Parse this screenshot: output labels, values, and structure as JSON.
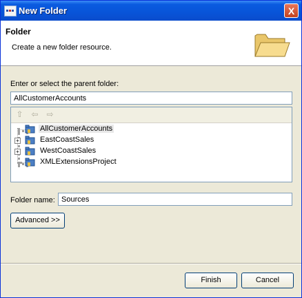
{
  "window": {
    "title": "New Folder",
    "close_label": "X"
  },
  "banner": {
    "title": "Folder",
    "description": "Create a new folder resource."
  },
  "parent": {
    "label": "Enter or select the parent folder:",
    "value": "AllCustomerAccounts"
  },
  "tree": {
    "toolbar_icons": [
      "home-icon",
      "back-icon",
      "forward-icon"
    ],
    "items": [
      {
        "label": "AllCustomerAccounts",
        "expandable": false,
        "selected": true
      },
      {
        "label": "EastCoastSales",
        "expandable": true,
        "selected": false
      },
      {
        "label": "WestCoastSales",
        "expandable": true,
        "selected": false
      },
      {
        "label": "XMLExtensionsProject",
        "expandable": false,
        "selected": false
      }
    ]
  },
  "folder_name": {
    "label": "Folder name:",
    "value": "Sources"
  },
  "buttons": {
    "advanced": "Advanced >>",
    "finish": "Finish",
    "cancel": "Cancel"
  },
  "colors": {
    "title_bar": "#0a5be0",
    "dialog_bg": "#ece9d8",
    "close_button": "#d1502d"
  }
}
